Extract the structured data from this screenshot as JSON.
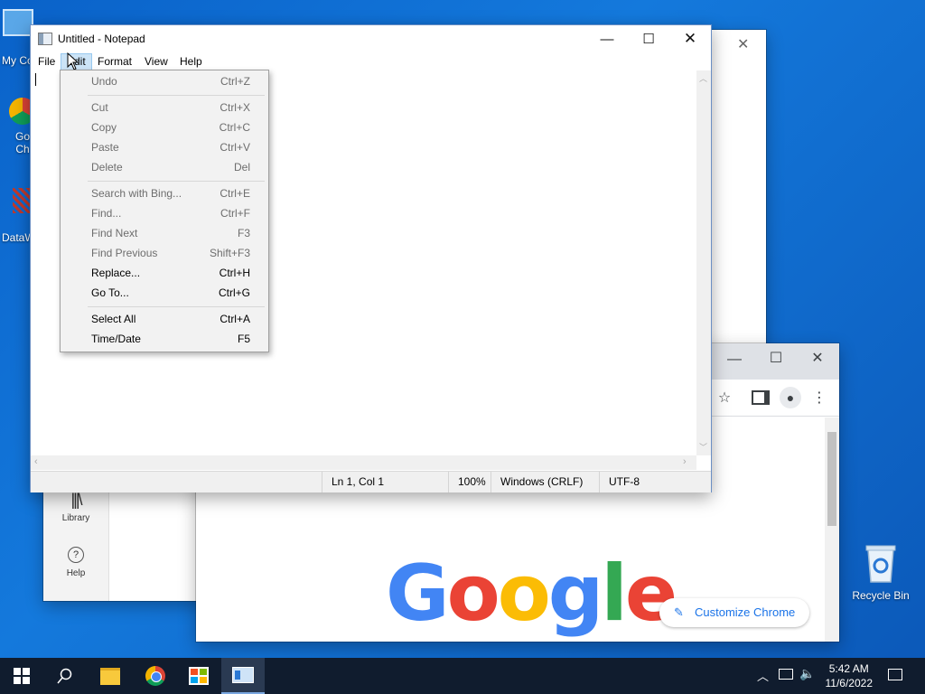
{
  "desktop": {
    "icons": [
      {
        "label": "My Co",
        "icon": "computer-icon"
      },
      {
        "label": "Go\nCh",
        "icon": "chrome-shortcut-icon"
      },
      {
        "label": "DataW",
        "icon": "datawrapper-shortcut-icon"
      },
      {
        "label": "Recycle Bin",
        "icon": "recycle-bin-icon"
      }
    ]
  },
  "notepad": {
    "title": "Untitled - Notepad",
    "menu": [
      "File",
      "Edit",
      "Format",
      "View",
      "Help"
    ],
    "active_menu": "Edit",
    "status": {
      "position": "Ln 1, Col 1",
      "zoom": "100%",
      "line_ending": "Windows (CRLF)",
      "encoding": "UTF-8"
    }
  },
  "edit_menu": {
    "items": [
      {
        "label": "Undo",
        "shortcut": "Ctrl+Z",
        "enabled": false
      },
      {
        "label": "Cut",
        "shortcut": "Ctrl+X",
        "enabled": false
      },
      {
        "label": "Copy",
        "shortcut": "Ctrl+C",
        "enabled": false
      },
      {
        "label": "Paste",
        "shortcut": "Ctrl+V",
        "enabled": false
      },
      {
        "label": "Delete",
        "shortcut": "Del",
        "enabled": false
      },
      {
        "label": "Search with Bing...",
        "shortcut": "Ctrl+E",
        "enabled": false
      },
      {
        "label": "Find...",
        "shortcut": "Ctrl+F",
        "enabled": false
      },
      {
        "label": "Find Next",
        "shortcut": "F3",
        "enabled": false
      },
      {
        "label": "Find Previous",
        "shortcut": "Shift+F3",
        "enabled": false
      },
      {
        "label": "Replace...",
        "shortcut": "Ctrl+H",
        "enabled": true
      },
      {
        "label": "Go To...",
        "shortcut": "Ctrl+G",
        "enabled": true
      },
      {
        "label": "Select All",
        "shortcut": "Ctrl+A",
        "enabled": true
      },
      {
        "label": "Time/Date",
        "shortcut": "F5",
        "enabled": true
      }
    ]
  },
  "background_app": {
    "sidebar": [
      {
        "label": "Library",
        "icon": "library-icon"
      },
      {
        "label": "Help",
        "icon": "help-icon"
      }
    ]
  },
  "chrome": {
    "logo_text": "Google",
    "customize_label": "Customize Chrome"
  },
  "taskbar": {
    "time": "5:42 AM",
    "date": "11/6/2022"
  },
  "colors": {
    "google_blue": "#4285F4",
    "google_red": "#EA4335",
    "google_yellow": "#FBBC05",
    "google_green": "#34A853",
    "menu_highlight": "#cce4f7"
  }
}
